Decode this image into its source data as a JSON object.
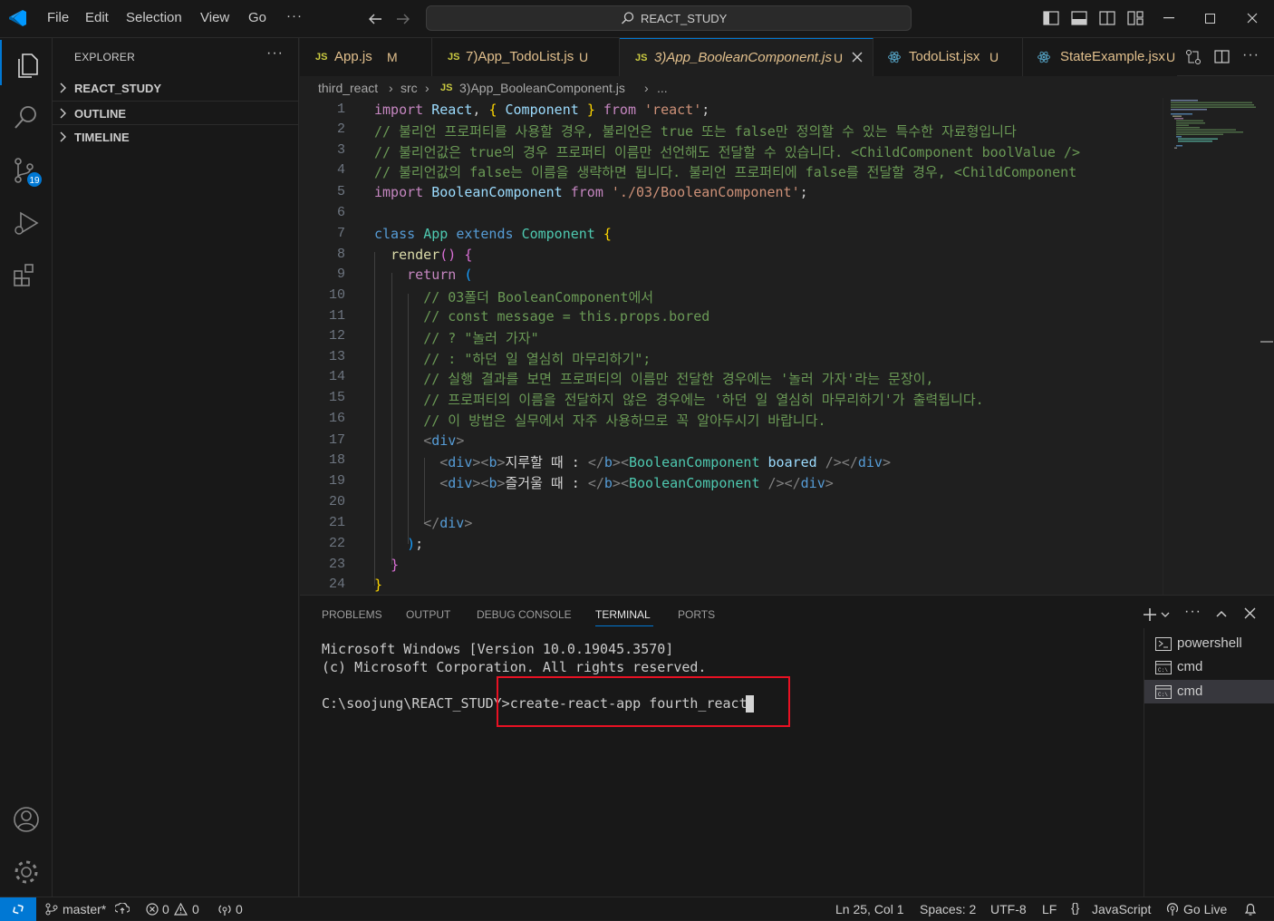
{
  "menu": [
    "File",
    "Edit",
    "Selection",
    "View",
    "Go"
  ],
  "search": {
    "text": "REACT_STUDY"
  },
  "sidebar": {
    "title": "EXPLORER",
    "sections": [
      "REACT_STUDY",
      "OUTLINE",
      "TIMELINE"
    ]
  },
  "activity": {
    "scm_badge": "19"
  },
  "tabs": [
    {
      "icon": "JS",
      "name": "App.js",
      "status": "M"
    },
    {
      "icon": "JS",
      "name": "7)App_TodoList.js",
      "status": "U"
    },
    {
      "icon": "JS",
      "name": "3)App_BooleanComponent.js",
      "status": "U"
    },
    {
      "icon": "react",
      "name": "TodoList.jsx",
      "status": "U"
    },
    {
      "icon": "react",
      "name": "StateExample.jsx",
      "status": "U"
    }
  ],
  "breadcrumb": {
    "p1": "third_react",
    "p2": "src",
    "p3": "3)App_BooleanComponent.js",
    "p4": "...",
    "icon": "JS"
  },
  "editor": {
    "line_numbers": [
      "1",
      "2",
      "3",
      "4",
      "5",
      "6",
      "7",
      "8",
      "9",
      "10",
      "11",
      "12",
      "13",
      "14",
      "15",
      "16",
      "17",
      "18",
      "19",
      "20",
      "21",
      "22",
      "23",
      "24"
    ]
  },
  "panel": {
    "tabs": [
      "PROBLEMS",
      "OUTPUT",
      "DEBUG CONSOLE",
      "TERMINAL",
      "PORTS"
    ],
    "terminal_lines": [
      "Microsoft Windows [Version 10.0.19045.3570]",
      "(c) Microsoft Corporation. All rights reserved.",
      "",
      "C:\\soojung\\REACT_STUDY>create-react-app fourth_react"
    ],
    "terminals": [
      "powershell",
      "cmd",
      "cmd"
    ]
  },
  "status": {
    "branch": "master*",
    "errors": "0",
    "warnings": "0",
    "ports": "0",
    "position": "Ln 25, Col 1",
    "spaces": "Spaces: 2",
    "encoding": "UTF-8",
    "eol": "LF",
    "language": "JavaScript",
    "golive": "Go Live"
  },
  "colors": {
    "accent": "#0078d4",
    "highlight_box": "#e81123",
    "modified": "#e2c08d"
  }
}
